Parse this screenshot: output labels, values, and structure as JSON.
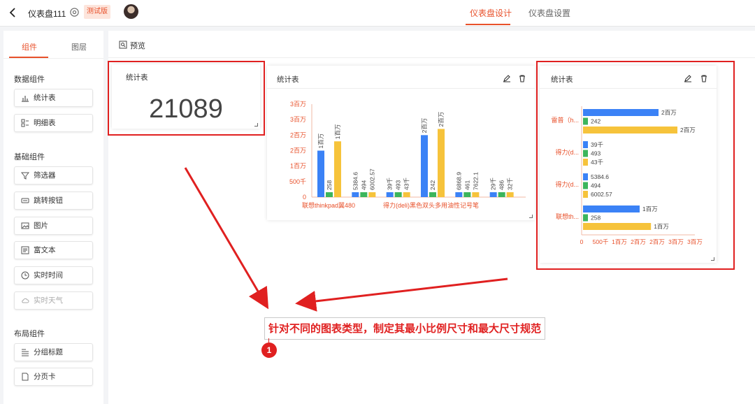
{
  "header": {
    "title": "仪表盘111",
    "badge": "测试版",
    "tabs": [
      {
        "label": "仪表盘设计",
        "active": true
      },
      {
        "label": "仪表盘设置",
        "active": false
      }
    ]
  },
  "sidebar": {
    "tabs": [
      {
        "label": "组件",
        "active": true
      },
      {
        "label": "图层",
        "active": false
      }
    ],
    "groups": [
      {
        "title": "数据组件",
        "items": [
          {
            "label": "统计表",
            "icon": "bar-chart-icon"
          },
          {
            "label": "明细表",
            "icon": "table-icon"
          }
        ]
      },
      {
        "title": "基础组件",
        "items": [
          {
            "label": "筛选器",
            "icon": "filter-icon"
          },
          {
            "label": "跳转按钮",
            "icon": "link-button-icon"
          },
          {
            "label": "图片",
            "icon": "image-icon"
          },
          {
            "label": "富文本",
            "icon": "rich-text-icon"
          },
          {
            "label": "实时时间",
            "icon": "clock-icon"
          },
          {
            "label": "实时天气",
            "icon": "cloud-icon",
            "disabled": true
          }
        ]
      },
      {
        "title": "布局组件",
        "items": [
          {
            "label": "分组标题",
            "icon": "title-icon"
          },
          {
            "label": "分页卡",
            "icon": "page-icon"
          }
        ]
      }
    ]
  },
  "toolbar": {
    "preview_label": "预览"
  },
  "cards": {
    "kpi": {
      "title": "统计表",
      "value": "21089"
    },
    "vertical_bar": {
      "title": "统计表"
    },
    "horizontal_bar": {
      "title": "统计表"
    }
  },
  "annotation": {
    "text": "针对不同的图表类型，制定其最小比例尺寸和最大尺寸规范",
    "marker": "1"
  },
  "colors": {
    "accent": "#e8512b",
    "annotation_red": "#e02020",
    "series": [
      "#3b82f6",
      "#3cb55c",
      "#f6c33b"
    ]
  },
  "chart_data": [
    {
      "type": "bar",
      "orientation": "vertical",
      "categories": [
        "联想thinkpad翼480",
        "",
        "",
        "得力(deli)黑色双头多用油性记号笔",
        "",
        ""
      ],
      "series": [
        {
          "values": [
            1500000,
            5384.6,
            39000,
            2000000,
            6868.9,
            29000
          ],
          "labels": [
            "1百万",
            "5384.6",
            "39千",
            "2百万",
            "6868.9",
            "29千"
          ]
        },
        {
          "values": [
            258,
            494,
            493,
            242,
            461,
            486
          ],
          "labels": [
            "258",
            "494",
            "493",
            "242",
            "461",
            "486"
          ]
        },
        {
          "values": [
            1800000,
            6002.57,
            43000,
            2200000,
            7622.1,
            32000
          ],
          "labels": [
            "1百万",
            "6002.57",
            "43千",
            "2百万",
            "7622.1",
            "32千"
          ]
        }
      ],
      "y_ticks": [
        "0",
        "500千",
        "1百万",
        "2百万",
        "2百万",
        "3百万",
        "3百万"
      ],
      "ylim": [
        0,
        3000000
      ]
    },
    {
      "type": "bar",
      "orientation": "horizontal",
      "categories": [
        "雷普（h...",
        "得力(d...",
        "得力(d...",
        "联想th..."
      ],
      "series": [
        {
          "values": [
            2000000,
            39000,
            5384.6,
            1500000
          ],
          "labels": [
            "2百万",
            "39千",
            "5384.6",
            "1百万"
          ]
        },
        {
          "values": [
            242,
            493,
            494,
            258
          ],
          "labels": [
            "242",
            "493",
            "494",
            "258"
          ]
        },
        {
          "values": [
            2500000,
            43000,
            6002.57,
            1800000
          ],
          "labels": [
            "2百万",
            "43千",
            "6002.57",
            "1百万"
          ]
        }
      ],
      "x_ticks": [
        "0",
        "500千",
        "1百万",
        "2百万",
        "2百万",
        "3百万",
        "3百万"
      ],
      "xlim": [
        0,
        3000000
      ]
    }
  ]
}
